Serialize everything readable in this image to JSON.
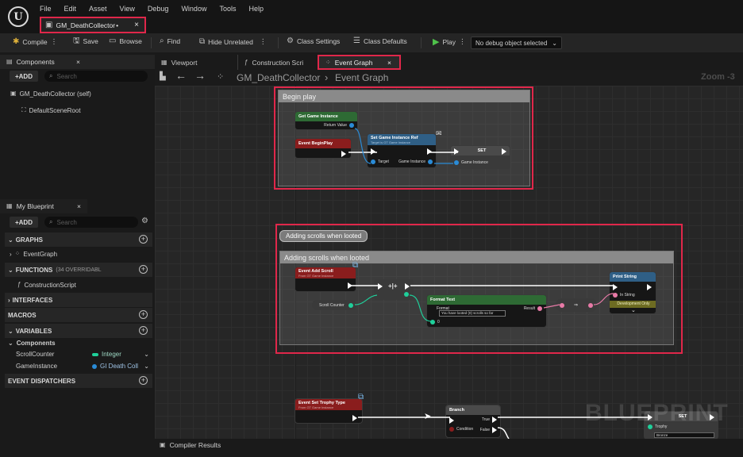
{
  "menu": [
    "File",
    "Edit",
    "Asset",
    "View",
    "Debug",
    "Window",
    "Tools",
    "Help"
  ],
  "asset_tab": {
    "label": "GM_DeathCollector",
    "modified": "•",
    "close": "×"
  },
  "toolbar": {
    "compile": "Compile",
    "save": "Save",
    "browse": "Browse",
    "find": "Find",
    "hide_unrelated": "Hide Unrelated",
    "class_settings": "Class Settings",
    "class_defaults": "Class Defaults",
    "play": "Play",
    "debug_object": "No debug object selected"
  },
  "components_panel": {
    "title": "Components",
    "close": "×",
    "add": "+ADD",
    "search_placeholder": "Search",
    "items": [
      "GM_DeathCollector (self)",
      "DefaultSceneRoot"
    ]
  },
  "my_blueprint": {
    "title": "My Blueprint",
    "close": "×",
    "add": "+ADD",
    "search_placeholder": "Search",
    "graphs_label": "GRAPHS",
    "event_graph": "EventGraph",
    "functions_label": "FUNCTIONS",
    "functions_badge": "(34 OVERRIDABL",
    "construction_script": "ConstructionScript",
    "interfaces_label": "INTERFACES",
    "macros_label": "MACROS",
    "variables_label": "VARIABLES",
    "components_label": "Components",
    "variables": [
      {
        "name": "ScrollCounter",
        "type": "Integer",
        "color": "#1fcf9a"
      },
      {
        "name": "GameInstance",
        "type": "GI Death Coll",
        "color": "#2a8bd6"
      }
    ],
    "event_dispatchers_label": "EVENT DISPATCHERS"
  },
  "graph_tabs": {
    "viewport": "Viewport",
    "construction": "Construction Scri",
    "event_graph": "Event Graph",
    "close": "×"
  },
  "breadcrumb": {
    "root": "GM_DeathCollector",
    "separator": "›",
    "current": "Event Graph",
    "zoom": "Zoom -3"
  },
  "comments": {
    "begin_play": "Begin play",
    "adding_scrolls": "Adding scrolls when looted",
    "bubble": "Adding scrolls when looted"
  },
  "nodes": {
    "get_game_instance": {
      "title": "Get Game Instance",
      "pin": "Return Value"
    },
    "event_begin_play": {
      "title": "Event BeginPlay"
    },
    "set_game_instance_ref": {
      "title": "Set Game Instance Ref",
      "subtitle": "Target is GT Game Instance",
      "target": "Target",
      "game_instance": "Game Instance"
    },
    "set_node": {
      "title": "SET",
      "pin": "Game Instance"
    },
    "event_add_scroll": {
      "title": "Event Add Scroll",
      "subtitle": "From GT Game Instance"
    },
    "scroll_counter": {
      "title": "Scroll Counter"
    },
    "format_text": {
      "title": "Format Text",
      "format_label": "Format",
      "format_value": "You have looted {0} scrolls so far",
      "zero_pin": "0",
      "result": "Result"
    },
    "print_string": {
      "title": "Print String",
      "in_string": "In String",
      "dev_only": "Development Only"
    },
    "event_set_trophy": {
      "title": "Event Set Trophy Type",
      "subtitle": "From GT Game Instance"
    },
    "branch": {
      "title": "Branch",
      "condition": "Condition",
      "true": "True",
      "false": "False"
    },
    "set_trophy": {
      "title": "SET",
      "pin": "Trophy",
      "value": "Bronze"
    }
  },
  "watermark": "BLUEPRINT",
  "bottom": {
    "compiler_results": "Compiler Results"
  },
  "colors": {
    "highlight": "#e0274a",
    "exec": "#ffffff",
    "integer": "#1fcf9a",
    "object": "#2a8bd6",
    "text": "#e87aa7"
  }
}
